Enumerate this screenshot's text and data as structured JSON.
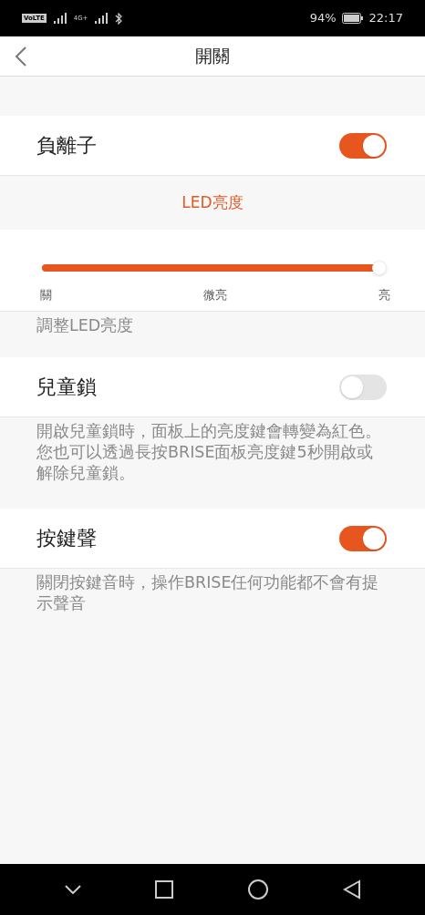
{
  "status_bar": {
    "volte": "VoLTE",
    "network": "4G+",
    "battery": "94%",
    "time": "22:17"
  },
  "header": {
    "title": "開關"
  },
  "items": [
    {
      "kind": "toggle",
      "label": "負離子",
      "on": true
    },
    {
      "kind": "slider",
      "title": "LED亮度",
      "level": 1,
      "ticks": [
        "關",
        "微亮",
        "亮"
      ],
      "hint": "調整LED亮度"
    },
    {
      "kind": "toggle",
      "label": "兒童鎖",
      "on": false,
      "hint": "開啟兒童鎖時，面板上的亮度鍵會轉變為紅色。您也可以透過長按BRISE面板亮度鍵5秒開啟或解除兒童鎖。"
    },
    {
      "kind": "toggle",
      "label": "按鍵聲",
      "on": true,
      "hint": "關閉按鍵音時，操作BRISE任何功能都不會有提示聲音"
    }
  ]
}
